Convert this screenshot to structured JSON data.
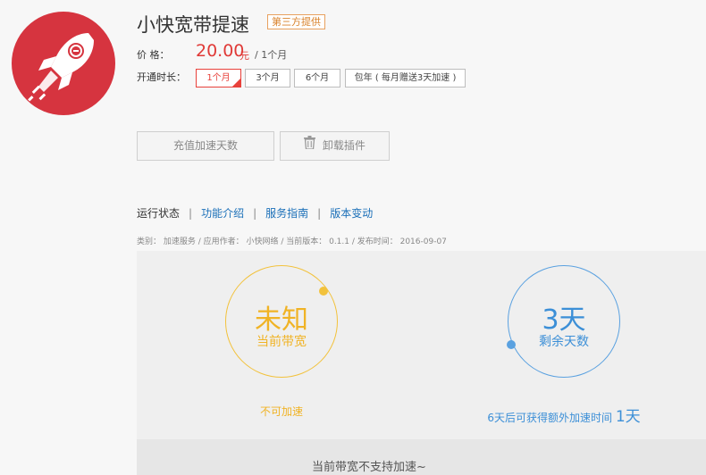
{
  "app": {
    "title": "小快宽带提速",
    "badge": "第三方提供"
  },
  "price": {
    "label": "价 格：",
    "value": "20.00",
    "unit": "元",
    "period": " / 1个月"
  },
  "duration": {
    "label": "开通时长：",
    "options": [
      "1个月",
      "3个月",
      "6个月",
      "包年 ( 每月赠送3天加速 )"
    ],
    "selected": "1个月"
  },
  "actions": {
    "recharge": "充值加速天数",
    "uninstall": "卸载插件"
  },
  "tabs": [
    "运行状态",
    "功能介绍",
    "服务指南",
    "版本变动"
  ],
  "meta": "类别： 加速服务 / 应用作者： 小快网络 / 当前版本： 0.1.1 / 发布时间： 2016-09-07",
  "status": {
    "bandwidth_value": "未知",
    "bandwidth_label": "当前带宽",
    "bandwidth_desc": "不可加速",
    "days_value": "3天",
    "days_label": "剩余天数",
    "extra_text": "6天后可获得额外加速时间",
    "extra_days": "1天"
  },
  "notice": "当前带宽不支持加速~",
  "colors": {
    "brand_red": "#d6343f",
    "price_red": "#e03a37",
    "link_blue": "#1a6fb8",
    "status_yellow": "#f0b325",
    "status_blue": "#3c8fd7"
  }
}
